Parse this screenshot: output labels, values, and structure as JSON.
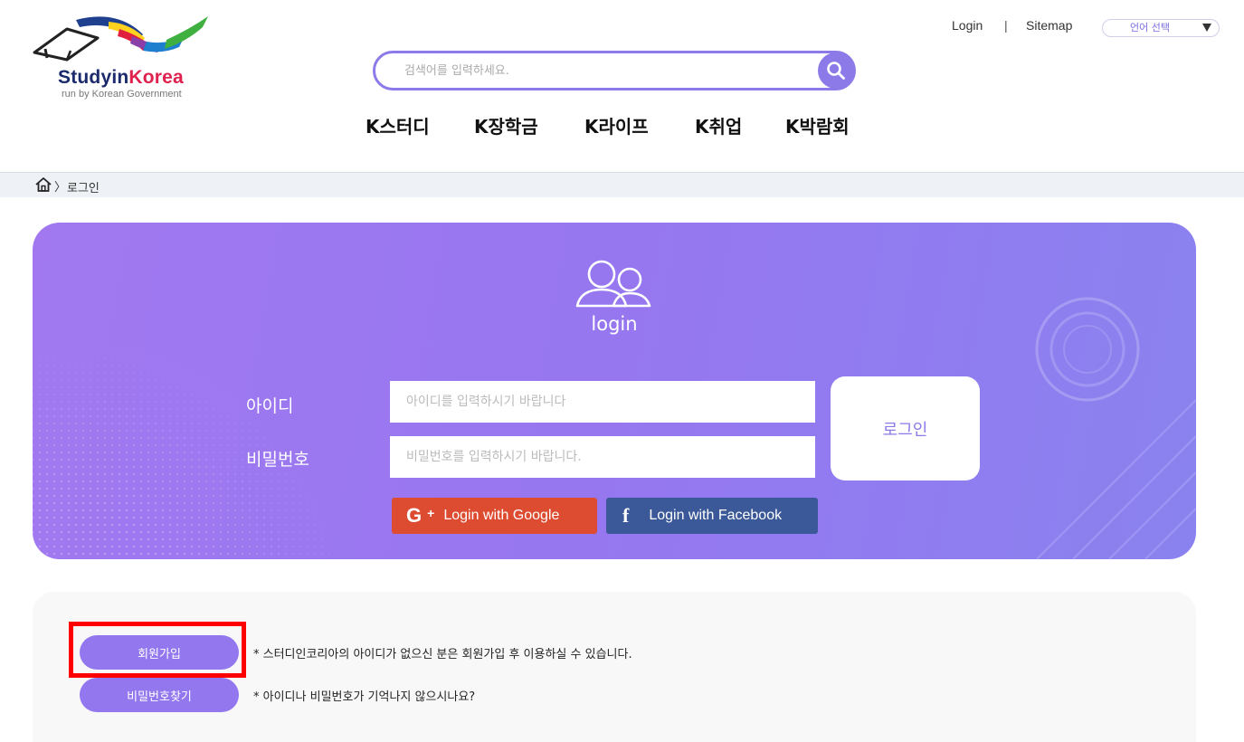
{
  "header": {
    "logo": {
      "brand_part1": "Studyin",
      "brand_part2": "Korea",
      "subtitle": "run by Korean Government"
    },
    "search": {
      "placeholder": "검색어를 입력하세요.",
      "value": ""
    },
    "util": {
      "login": "Login",
      "separator": "|",
      "sitemap": "Sitemap",
      "language_select": "언어 선택"
    },
    "nav": [
      {
        "label": "K스터디"
      },
      {
        "label": "K장학금"
      },
      {
        "label": "K라이프"
      },
      {
        "label": "K취업"
      },
      {
        "label": "K박람회"
      }
    ]
  },
  "breadcrumb": {
    "separator": "〉",
    "current": "로그인"
  },
  "login": {
    "title": "login",
    "id_label": "아이디",
    "id_placeholder": "아이디를 입력하시기 바랍니다",
    "pw_label": "비밀번호",
    "pw_placeholder": "비밀번호를 입력하시기 바랍니다.",
    "submit_label": "로그인",
    "google_label": "Login with Google",
    "google_icon_text": "G",
    "google_plus_text": "+",
    "facebook_label": "Login with Facebook",
    "facebook_icon_text": "f"
  },
  "member": {
    "join_label": "회원가입",
    "join_note": "* 스터디인코리아의 아이디가 없으신 분은 회원가입 후 이용하실 수 있습니다.",
    "find_label": "비밀번호찾기",
    "find_note": "* 아이디나 비밀번호가 기억나지 않으시나요?"
  },
  "colors": {
    "accent": "#8b7ae8",
    "panel_start": "#a178f0",
    "panel_end": "#8a82ef",
    "google": "#dd4b30",
    "facebook": "#3b5998",
    "highlight": "#ff0000"
  }
}
